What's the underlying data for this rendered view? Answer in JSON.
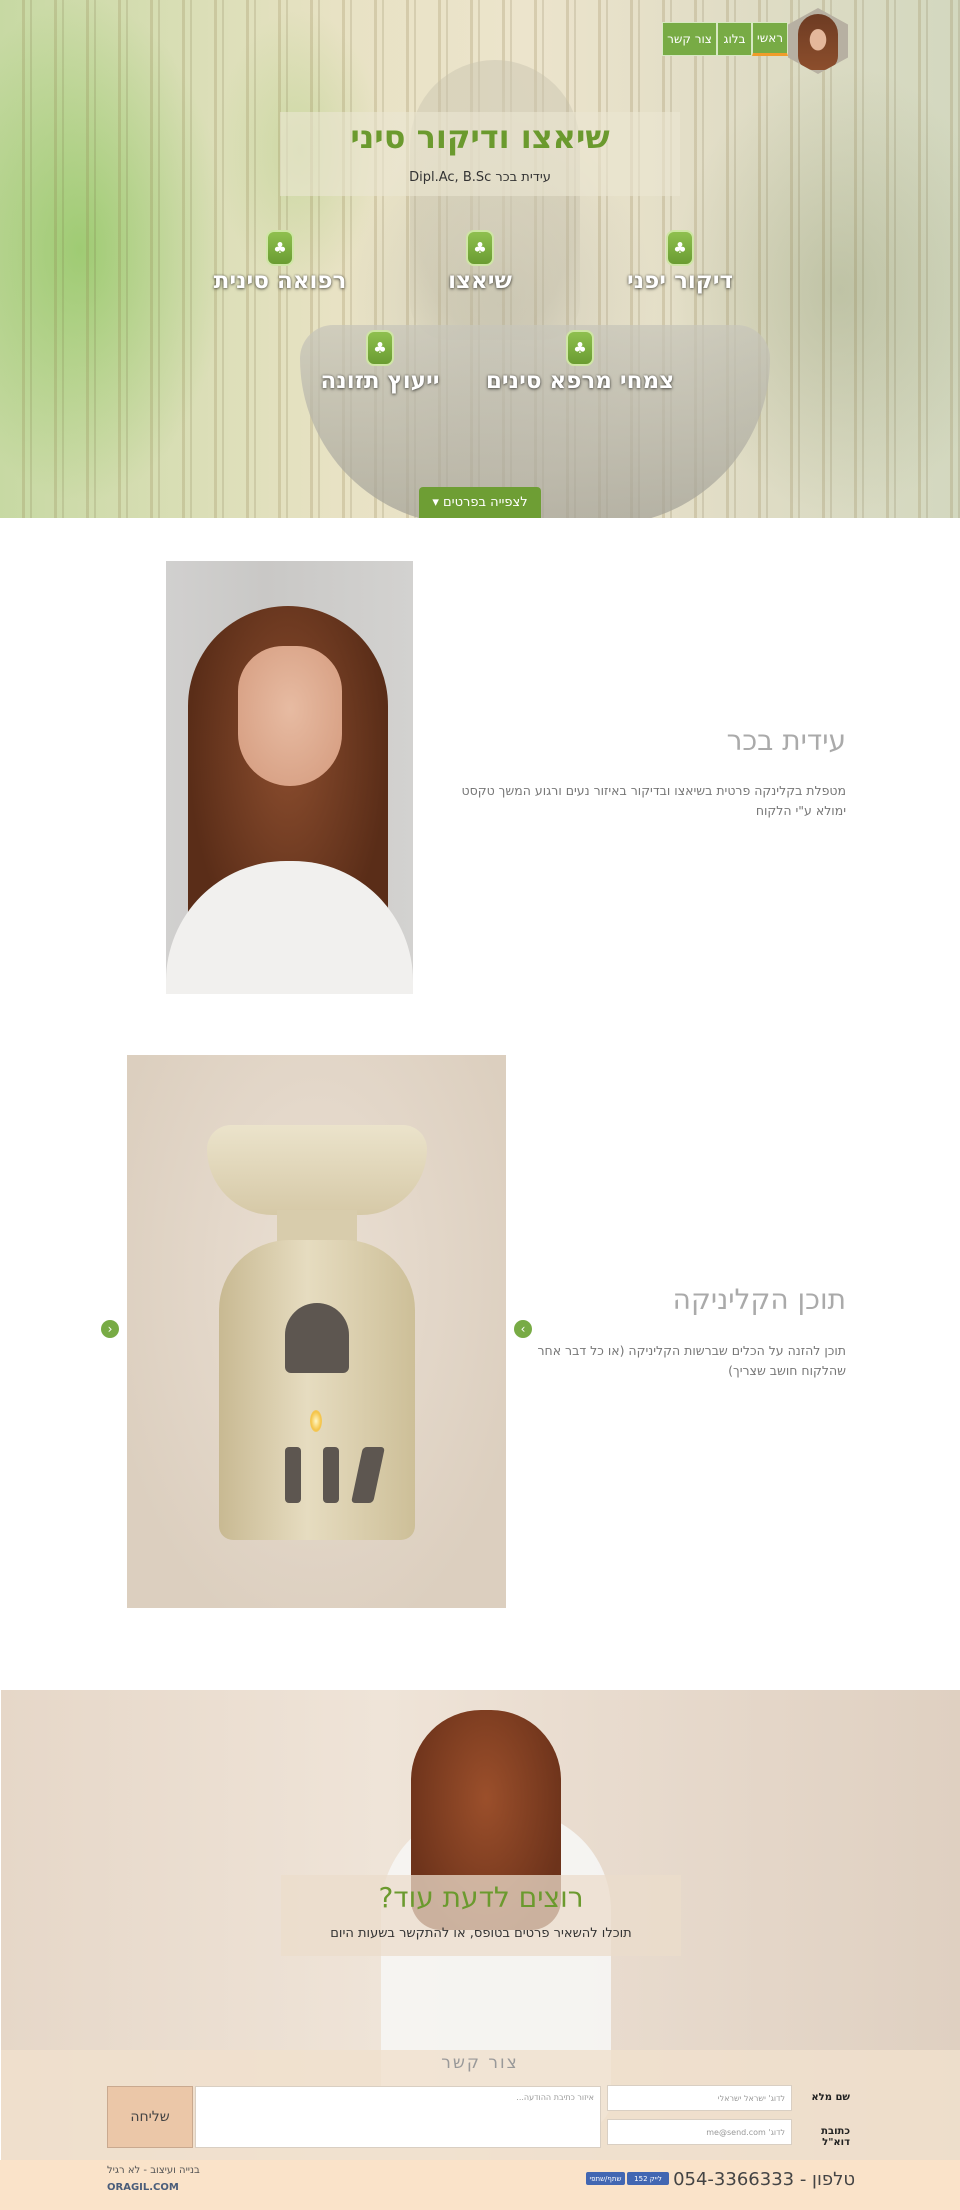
{
  "nav": {
    "home": "ראשי",
    "blog": "בלוג",
    "contact": "צור קשר"
  },
  "hero": {
    "title": "שיאצו ודיקור סיני",
    "subtitle": "עידית בכר Dipl.Ac, B.Sc",
    "services": [
      {
        "label": "דיקור יפני",
        "icon": "tree-icon"
      },
      {
        "label": "שיאצו",
        "icon": "tree-icon"
      },
      {
        "label": "רפואה סינית",
        "icon": "tree-icon"
      },
      {
        "label": "צמחי מרפא סינים",
        "icon": "tree-icon"
      },
      {
        "label": "ייעוץ תזונה",
        "icon": "tree-icon"
      }
    ],
    "more_button": "לצפייה בפרטים ▾"
  },
  "about": {
    "title": "עידית בכר",
    "text": "מטפלת בקלינקה פרטית בשיאצו ובדיקור באיזור נעים ורגוע המשך טקסט ימולא ע\"י הלקוח"
  },
  "clinic": {
    "title": "תוכן הקליניקה",
    "text": "תוכן להזנה על הכלים שברשות הקליניקה (או כל דבר אחר שהלקוח חושב שצריך)",
    "prev_icon": "chevron-left-icon",
    "next_icon": "chevron-right-icon"
  },
  "cta": {
    "title": "רוצים לדעת עוד?",
    "subtitle": "תוכלו להשאיר פרטים בטופס, או להתקשר בשעות היום"
  },
  "contact_form": {
    "title": "צור קשר",
    "name_label": "שם מלא",
    "name_placeholder": "לדוג' ישראל ישראלי",
    "email_label": "כתובת דוא\"ל",
    "email_placeholder": "לדוג' me@send.com",
    "message_placeholder": "איזור כתיבת ההודעה...",
    "send": "שליחה"
  },
  "footer": {
    "phone": "טלפון - 054-3366333",
    "fb_like": "לייק 152",
    "fb_share": "שתף/שתפי",
    "credit": "בנייה ועיצוב - לא רגיל",
    "logo": "ORAGIL.COM"
  },
  "colors": {
    "accent": "#78ab45",
    "title_green": "#6b9a2e",
    "nav_active": "#f09c2b",
    "send_button": "#ebc7a8",
    "footer_bg": "#fae3c9"
  }
}
